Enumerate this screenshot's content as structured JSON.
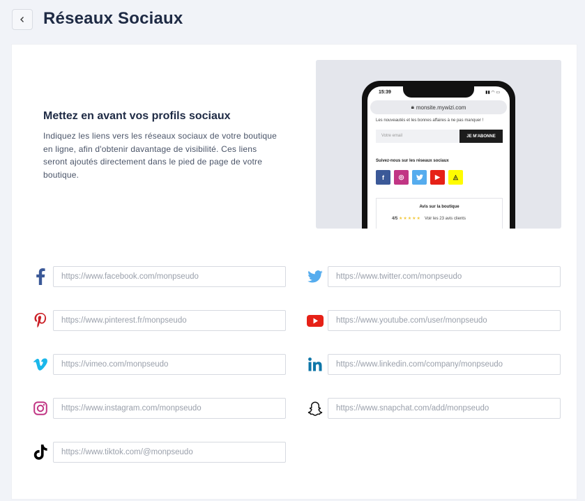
{
  "header": {
    "title": "Réseaux Sociaux"
  },
  "intro": {
    "heading": "Mettez en avant vos profils sociaux",
    "text": "Indiquez les liens vers les réseaux sociaux de votre boutique en ligne, afin d'obtenir davantage de visibilité. Ces liens seront ajoutés directement dans le pied de page de votre boutique."
  },
  "preview": {
    "time": "15:39",
    "url": "monsite.mywizi.com",
    "promo": "Les nouveautés et les bonnes affaires à ne pas manquer !",
    "email_placeholder": "Votre email",
    "subscribe": "JE M'ABONNE",
    "follow": "Suivez-nous sur les réseaux sociaux",
    "reviews_title": "Avis sur la boutique",
    "rating": "4/5",
    "stars": "★★★★★",
    "reviews_link": "Voir les 23 avis clients"
  },
  "colors": {
    "facebook": "#3b5998",
    "twitter": "#55acee",
    "pinterest": "#cb2027",
    "youtube": "#e62117",
    "vimeo": "#1ab7ea",
    "linkedin": "#0e76a8",
    "instagram": "#c13584",
    "snapchat": "#fffc00",
    "tiktok": "#000000"
  },
  "fields": {
    "facebook": {
      "icon": "facebook-icon",
      "placeholder": "https://www.facebook.com/monpseudo",
      "value": ""
    },
    "twitter": {
      "icon": "twitter-icon",
      "placeholder": "https://www.twitter.com/monpseudo",
      "value": ""
    },
    "pinterest": {
      "icon": "pinterest-icon",
      "placeholder": "https://www.pinterest.fr/monpseudo",
      "value": ""
    },
    "youtube": {
      "icon": "youtube-icon",
      "placeholder": "https://www.youtube.com/user/monpseudo",
      "value": ""
    },
    "vimeo": {
      "icon": "vimeo-icon",
      "placeholder": "https://vimeo.com/monpseudo",
      "value": ""
    },
    "linkedin": {
      "icon": "linkedin-icon",
      "placeholder": "https://www.linkedin.com/company/monpseudo",
      "value": ""
    },
    "instagram": {
      "icon": "instagram-icon",
      "placeholder": "https://www.instagram.com/monpseudo",
      "value": ""
    },
    "snapchat": {
      "icon": "snapchat-icon",
      "placeholder": "https://www.snapchat.com/add/monpseudo",
      "value": ""
    },
    "tiktok": {
      "icon": "tiktok-icon",
      "placeholder": "https://www.tiktok.com/@monpseudo",
      "value": ""
    }
  }
}
